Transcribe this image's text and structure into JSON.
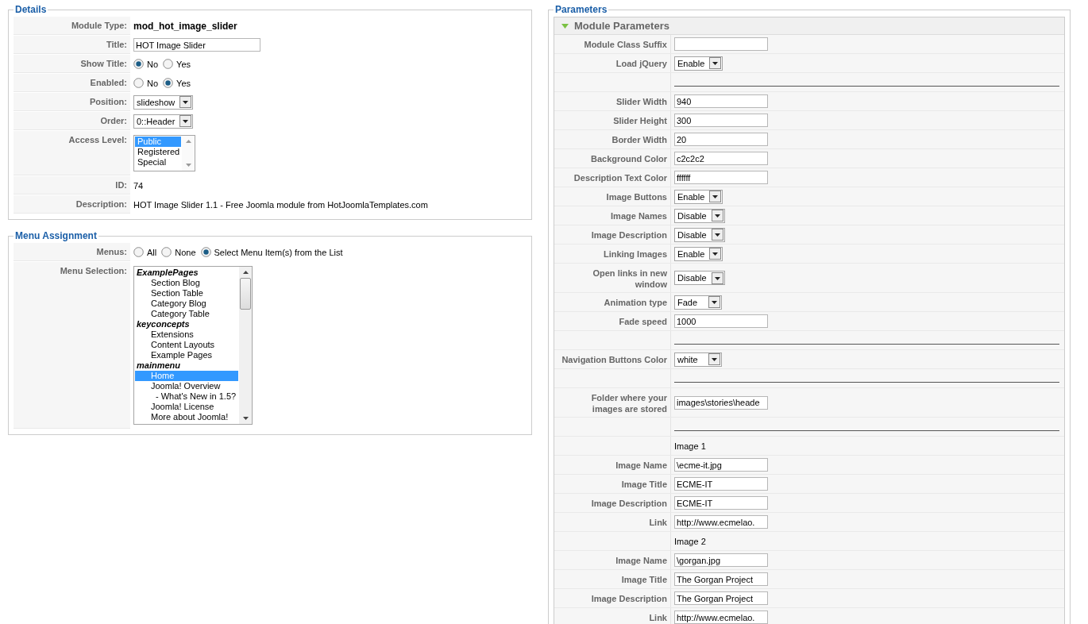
{
  "details": {
    "legend": "Details",
    "rows": [
      {
        "label": "Module Type:",
        "kind": "bold_text",
        "value": "mod_hot_image_slider"
      },
      {
        "label": "Title:",
        "kind": "input",
        "value": "HOT Image Slider"
      },
      {
        "label": "Show Title:",
        "kind": "radio",
        "options": [
          {
            "label": "No",
            "selected": true
          },
          {
            "label": "Yes",
            "selected": false
          }
        ]
      },
      {
        "label": "Enabled:",
        "kind": "radio",
        "options": [
          {
            "label": "No",
            "selected": false
          },
          {
            "label": "Yes",
            "selected": true
          }
        ]
      },
      {
        "label": "Position:",
        "kind": "select",
        "value": "slideshow"
      },
      {
        "label": "Order:",
        "kind": "select",
        "value": "0::Header"
      },
      {
        "label": "Access Level:",
        "kind": "listbox",
        "options": [
          {
            "label": "Public",
            "selected": true
          },
          {
            "label": "Registered",
            "selected": false
          },
          {
            "label": "Special",
            "selected": false
          }
        ]
      },
      {
        "label": "ID:",
        "kind": "text",
        "value": "74"
      },
      {
        "label": "Description:",
        "kind": "text",
        "value": "HOT Image Slider 1.1 - Free Joomla module from HotJoomlaTemplates.com"
      }
    ]
  },
  "menu_assignment": {
    "legend": "Menu Assignment",
    "rows": [
      {
        "label": "Menus:",
        "kind": "radio",
        "options": [
          {
            "label": "All",
            "selected": false
          },
          {
            "label": "None",
            "selected": false
          },
          {
            "label": "Select Menu Item(s) from the List",
            "selected": true
          }
        ]
      },
      {
        "label": "Menu Selection:",
        "kind": "tree",
        "groups": [
          {
            "label": "ExamplePages",
            "children": [
              {
                "label": "Section Blog",
                "selected": false
              },
              {
                "label": "Section Table",
                "selected": false
              },
              {
                "label": "Category Blog",
                "selected": false
              },
              {
                "label": "Category Table",
                "selected": false
              }
            ]
          },
          {
            "label": "keyconcepts",
            "children": [
              {
                "label": "Extensions",
                "selected": false
              },
              {
                "label": "Content Layouts",
                "selected": false
              },
              {
                "label": "Example Pages",
                "selected": false
              }
            ]
          },
          {
            "label": "mainmenu",
            "children": [
              {
                "label": "Home",
                "selected": true
              },
              {
                "label": "Joomla! Overview",
                "selected": false,
                "children": [
                  {
                    "label": "- What's New in 1.5?",
                    "selected": false
                  }
                ]
              },
              {
                "label": "Joomla! License",
                "selected": false
              },
              {
                "label": "More about Joomla!",
                "selected": false
              }
            ]
          }
        ]
      }
    ]
  },
  "parameters": {
    "legend": "Parameters",
    "panel": {
      "title": "Module Parameters",
      "expanded": true,
      "rows": [
        {
          "kind": "input",
          "label": "Module Class Suffix"
        },
        {
          "kind": "select",
          "label": "Load jQuery",
          "value": "Enable"
        },
        {
          "kind": "separator"
        },
        {
          "kind": "input",
          "label": "Slider Width",
          "value": "940"
        },
        {
          "kind": "input",
          "label": "Slider Height",
          "value": "300"
        },
        {
          "kind": "input",
          "label": "Border Width",
          "value": "20"
        },
        {
          "kind": "input",
          "label": "Background Color",
          "value": "c2c2c2"
        },
        {
          "kind": "input",
          "label": "Description Text Color",
          "value": "ffffff"
        },
        {
          "kind": "select",
          "label": "Image Buttons",
          "value": "Enable"
        },
        {
          "kind": "select",
          "label": "Image Names",
          "value": "Disable"
        },
        {
          "kind": "select",
          "label": "Image Description",
          "value": "Disable"
        },
        {
          "kind": "select",
          "label": "Linking Images",
          "value": "Enable"
        },
        {
          "kind": "select",
          "label": "Open links in new window",
          "value": "Disable"
        },
        {
          "kind": "select",
          "label": "Animation type",
          "value": "Fade"
        },
        {
          "kind": "input",
          "label": "Fade speed",
          "value": "1000"
        },
        {
          "kind": "separator"
        },
        {
          "kind": "select",
          "label": "Navigation Buttons Color",
          "value": "white"
        },
        {
          "kind": "separator"
        },
        {
          "kind": "input",
          "label": "Folder where your images are stored",
          "value": "images\\stories\\heade"
        },
        {
          "kind": "separator"
        },
        {
          "kind": "note",
          "value": "Image 1"
        },
        {
          "kind": "input",
          "label": "Image Name",
          "value": "\\ecme-it.jpg"
        },
        {
          "kind": "input",
          "label": "Image Title",
          "value": "ECME-IT"
        },
        {
          "kind": "input",
          "label": "Image Description",
          "value": "ECME-IT"
        },
        {
          "kind": "input",
          "label": "Link",
          "value": "http://www.ecmelao."
        },
        {
          "kind": "note",
          "value": "Image 2"
        },
        {
          "kind": "input",
          "label": "Image Name",
          "value": "\\gorgan.jpg"
        },
        {
          "kind": "input",
          "label": "Image Title",
          "value": "The Gorgan Project"
        },
        {
          "kind": "input",
          "label": "Image Description",
          "value": "The Gorgan Project"
        },
        {
          "kind": "input",
          "label": "Link",
          "value": "http://www.ecmelao."
        }
      ]
    }
  }
}
